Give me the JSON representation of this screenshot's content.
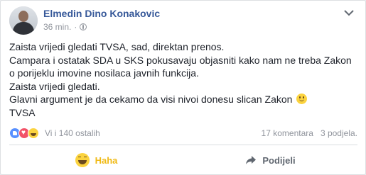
{
  "post": {
    "author": "Elmedin Dino Konakovic",
    "time": "36 min.",
    "privacy_icon": "globe-icon",
    "lines": [
      "Zaista vrijedi gledati TVSA, sad, direktan prenos.",
      "Campara i ostatak SDA u SKS pokusavaju objasniti kako nam ne treba Zakon",
      "o porijeklu imovine nosilaca javnih funkcija.",
      "Zaista vrijedi gledati.",
      "Glavni argument je da cekamo da visi nivoi donesu slican Zakon",
      "TVSA"
    ]
  },
  "stats": {
    "reactions": [
      "like-reaction-icon",
      "love-reaction-icon",
      "haha-reaction-icon"
    ],
    "reactors": "Vi i 140 ostalih",
    "comments": "17 komentara",
    "shares": "3 podjela."
  },
  "actions": {
    "haha_label": "Haha",
    "share_label": "Podijeli"
  },
  "colors": {
    "author": "#365899",
    "haha_active": "#f0ba15",
    "meta": "#90949c"
  }
}
